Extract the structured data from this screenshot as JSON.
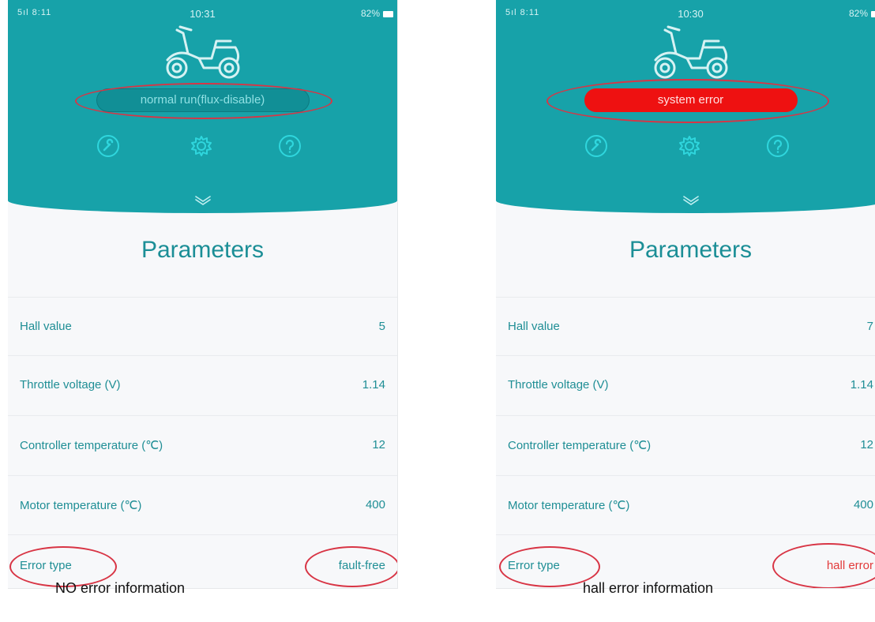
{
  "screens": [
    {
      "status_bar": {
        "signal": "5ıl 8:11",
        "time": "10:31",
        "battery": "82%"
      },
      "status_text": "normal run(flux-disable)",
      "status_type": "normal",
      "section_title": "Parameters",
      "params": [
        {
          "label": "Hall value",
          "value": "5"
        },
        {
          "label": "Throttle voltage (V)",
          "value": "1.14"
        },
        {
          "label": "Controller temperature (℃)",
          "value": "12"
        },
        {
          "label": "Motor temperature (℃)",
          "value": "400"
        },
        {
          "label": "Error type",
          "value": "fault-free"
        }
      ],
      "caption": "NO error information"
    },
    {
      "status_bar": {
        "signal": "5ıl 8:11",
        "time": "10:30",
        "battery": "82%"
      },
      "status_text": "system error",
      "status_type": "error",
      "section_title": "Parameters",
      "params": [
        {
          "label": "Hall value",
          "value": "7"
        },
        {
          "label": "Throttle voltage (V)",
          "value": "1.14"
        },
        {
          "label": "Controller temperature (℃)",
          "value": "12"
        },
        {
          "label": "Motor temperature (℃)",
          "value": "400"
        },
        {
          "label": "Error type",
          "value": "hall error"
        }
      ],
      "caption": "hall error information"
    }
  ],
  "icons": [
    "scooter-icon",
    "wrench-icon",
    "gear-icon",
    "help-icon",
    "chevron-down-icon"
  ],
  "colors": {
    "header": "#17a2a9",
    "text": "#1f8e95",
    "error": "#ee1111",
    "annotation": "#d83545"
  }
}
